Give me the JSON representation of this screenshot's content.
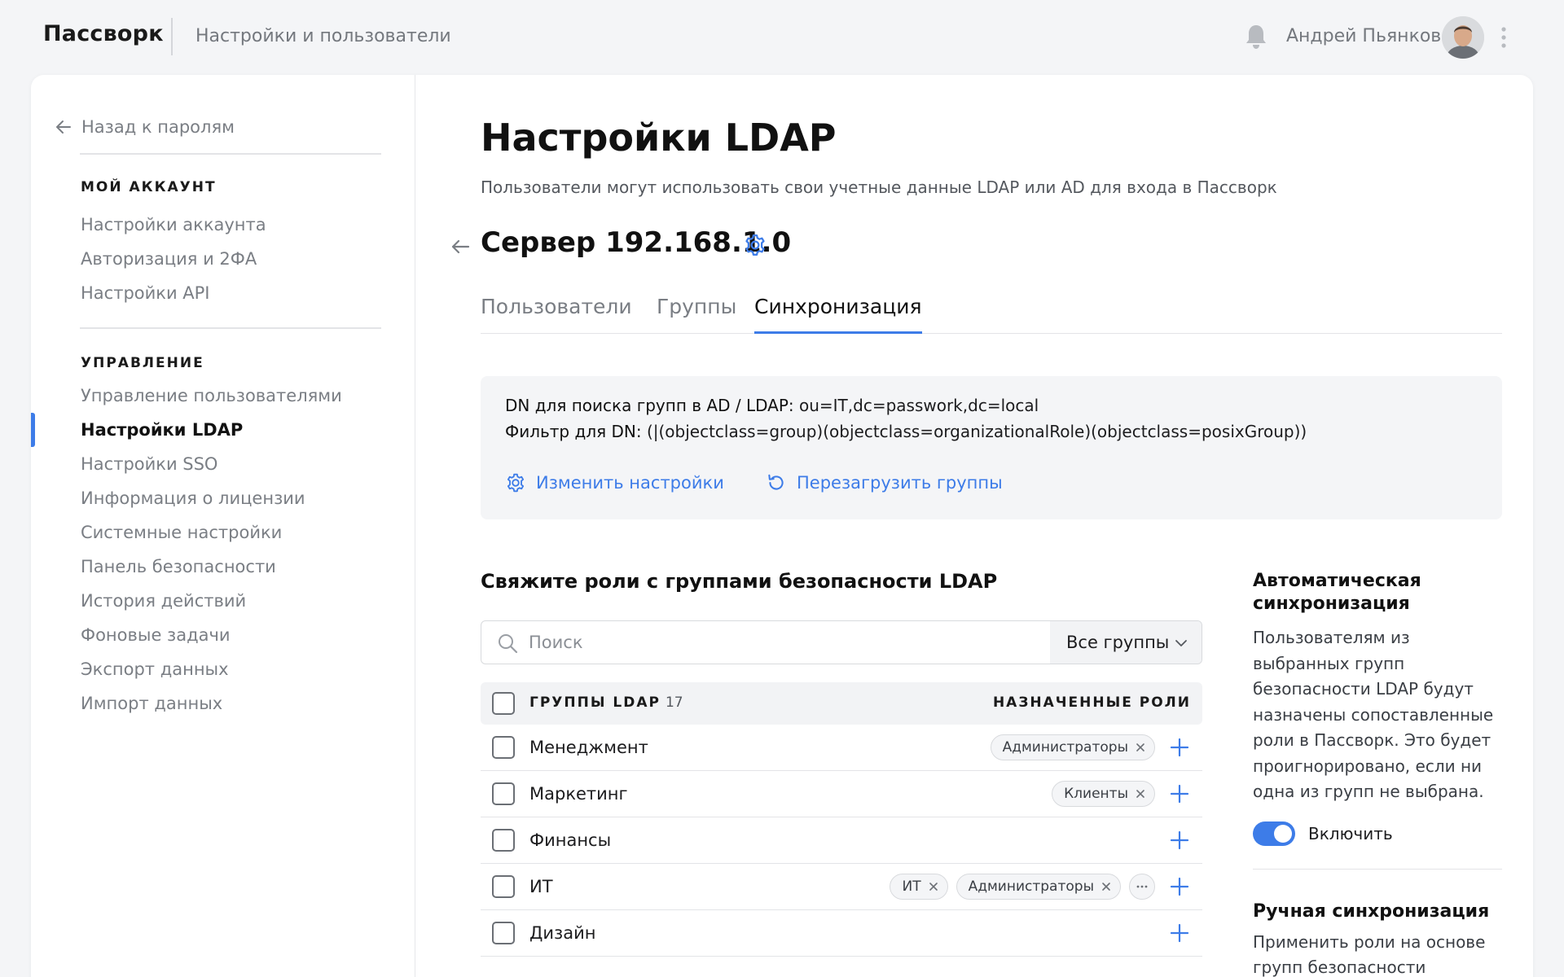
{
  "header": {
    "brand": "Пассворк",
    "breadcrumb": "Настройки и пользователи",
    "user_name": "Андрей Пьянков"
  },
  "sidebar": {
    "back_label": "Назад к паролям",
    "sections": [
      {
        "title": "МОЙ АККАУНТ",
        "items": [
          "Настройки аккаунта",
          "Авторизация и 2ФА",
          "Настройки API"
        ]
      },
      {
        "title": "УПРАВЛЕНИЕ",
        "items": [
          "Управление пользователями",
          "Настройки LDAP",
          "Настройки SSO",
          "Информация о лицензии",
          "Системные настройки",
          "Панель безопасности",
          "История действий",
          "Фоновые задачи",
          "Экспорт данных",
          "Импорт данных"
        ]
      }
    ],
    "active_item": "Настройки LDAP"
  },
  "main": {
    "title": "Настройки LDAP",
    "subtitle": "Пользователи могут использовать свои учетные данные LDAP или AD для входа в Пассворк",
    "server_title": "Сервер 192.168.1.0",
    "tabs": [
      "Пользователи",
      "Группы",
      "Синхронизация"
    ],
    "active_tab": "Синхронизация",
    "info": {
      "dn_label": "DN для поиска групп в AD / LDAP:",
      "dn_value": "ou=IT,dc=passwork,dc=local",
      "filter_label": "Фильтр для DN:",
      "filter_value": "(|(objectclass=group)(objectclass=organizationalRole)(objectclass=posixGroup))",
      "edit_label": "Изменить настройки",
      "reload_label": "Перезагрузить группы"
    },
    "roles_section": {
      "title": "Свяжите роли с группами безопасности LDAP",
      "search_placeholder": "Поиск",
      "filter_value": "Все группы",
      "col_groups": "ГРУППЫ LDAP",
      "groups_count": "17",
      "col_roles": "НАЗНАЧЕННЫЕ РОЛИ",
      "rows": [
        {
          "name": "Менеджмент",
          "roles": [
            "Администраторы"
          ],
          "more": false
        },
        {
          "name": "Маркетинг",
          "roles": [
            "Клиенты"
          ],
          "more": false
        },
        {
          "name": "Финансы",
          "roles": [],
          "more": false
        },
        {
          "name": "ИТ",
          "roles": [
            "ИТ",
            "Администраторы"
          ],
          "more": true
        },
        {
          "name": "Дизайн",
          "roles": [],
          "more": false
        }
      ]
    },
    "auto_sync": {
      "title": "Автоматическая синхронизация",
      "text": "Пользователям из выбранных групп безопасности LDAP будут назначены сопоставленные роли в Пассворк. Это будет проигнорировано, если ни одна из групп не выбрана.",
      "toggle_label": "Включить",
      "enabled": true
    },
    "manual_sync": {
      "title": "Ручная синхронизация",
      "text": "Применить роли на основе групп безопасности"
    }
  },
  "colors": {
    "accent": "#3d7ce8",
    "background": "#f4f5f7",
    "muted_text": "#7a7e84"
  },
  "icons": [
    "bell-icon",
    "avatar",
    "kebab-icon",
    "arrow-left-icon",
    "gear-icon",
    "reload-icon",
    "search-icon",
    "chevron-down-icon",
    "close-icon",
    "plus-icon",
    "more-icon"
  ]
}
